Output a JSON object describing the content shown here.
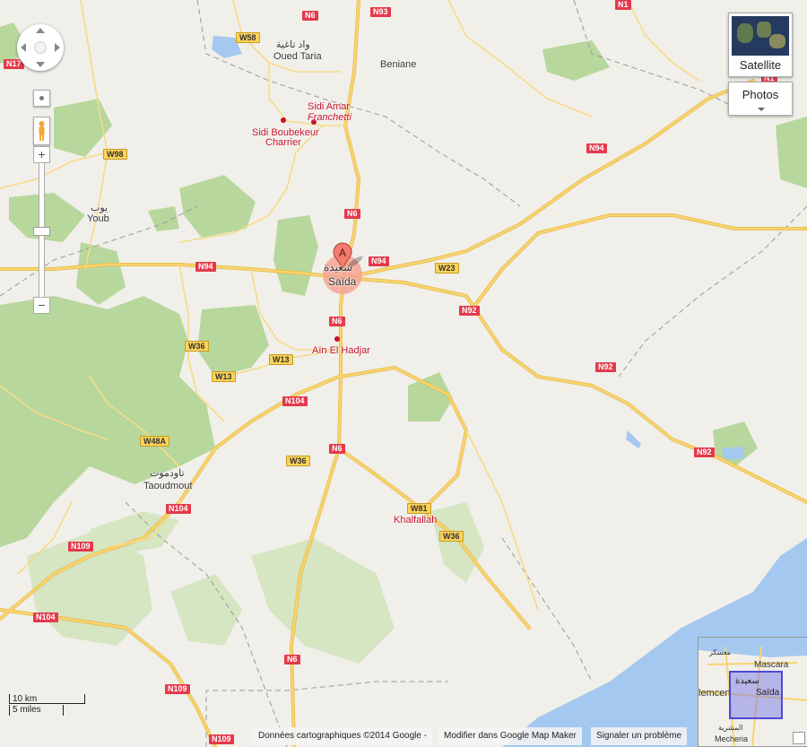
{
  "colors": {
    "land": "#f1efe9",
    "forest": "#b7d79c",
    "forest_light": "#d6e5c2",
    "sea": "#a4c8f0",
    "road_major": "#f8d46e",
    "road_border": "#e6b848",
    "boundary": "#9a9a9a"
  },
  "places": [
    {
      "name": "Oued Taria",
      "arabic": "واد تاغية"
    },
    {
      "name": "Beniane",
      "arabic": ""
    },
    {
      "name": "Sidi Amar Franchetti",
      "arabic": ""
    },
    {
      "name": "Sidi Boubekeur Charrier",
      "arabic": ""
    },
    {
      "name": "Youb",
      "arabic": "يوب"
    },
    {
      "name": "Saïda",
      "arabic": "سعيدة"
    },
    {
      "name": "Aïn El Hadjar",
      "arabic": ""
    },
    {
      "name": "Taoudmout",
      "arabic": "تاودموت"
    },
    {
      "name": "Khalfallah",
      "arabic": ""
    }
  ],
  "labels": {
    "oued_taria_ar": "واد تاغية",
    "oued_taria": "Oued Taria",
    "beniane": "Beniane",
    "sidi_amar_1": "Sidi Amar",
    "sidi_amar_2": "Franchetti",
    "sidi_boubekeur_1": "Sidi Boubekeur",
    "sidi_boubekeur_2": "Charrier",
    "youb_ar": "يوب",
    "youb": "Youb",
    "saida_ar": "سعيدة",
    "saida": "Saïda",
    "ain_el_hadjar": "Aïn El Hadjar",
    "taoudmout_ar": "تاودموت",
    "taoudmout": "Taoudmout",
    "khalfallah": "Khalfallah"
  },
  "roads": {
    "n6": "N6",
    "n93": "N93",
    "n17": "N17",
    "n1x": "N1",
    "n94": "N94",
    "n92": "N92",
    "n104": "N104",
    "n109": "N109",
    "w58": "W58",
    "w98": "W98",
    "w23": "W23",
    "w36": "W36",
    "w13": "W13",
    "w48a": "W48A",
    "w81": "W81"
  },
  "marker": {
    "letter": "A"
  },
  "map_type": {
    "satellite": "Satellite",
    "photos": "Photos"
  },
  "minimap": {
    "mascara": "Mascara",
    "mascara_ar": "معسكر",
    "tlemcen": "lemcen",
    "saida": "Saïda",
    "saida_ar": "سعيدة",
    "mecheria": "Mecheria",
    "mecheria_ar": "المشرية"
  },
  "scale": {
    "km": "10 km",
    "miles": "5 miles"
  },
  "footer": {
    "copyright": "Données cartographiques ©2014 Google -",
    "map_maker": "Modifier dans Google Map Maker",
    "report": "Signaler un problème"
  },
  "icons": {
    "pan": "pan-control-icon",
    "pegman": "pegman-icon",
    "zoom_in": "plus-icon",
    "zoom_out": "minus-icon",
    "marker": "map-pin-icon"
  }
}
